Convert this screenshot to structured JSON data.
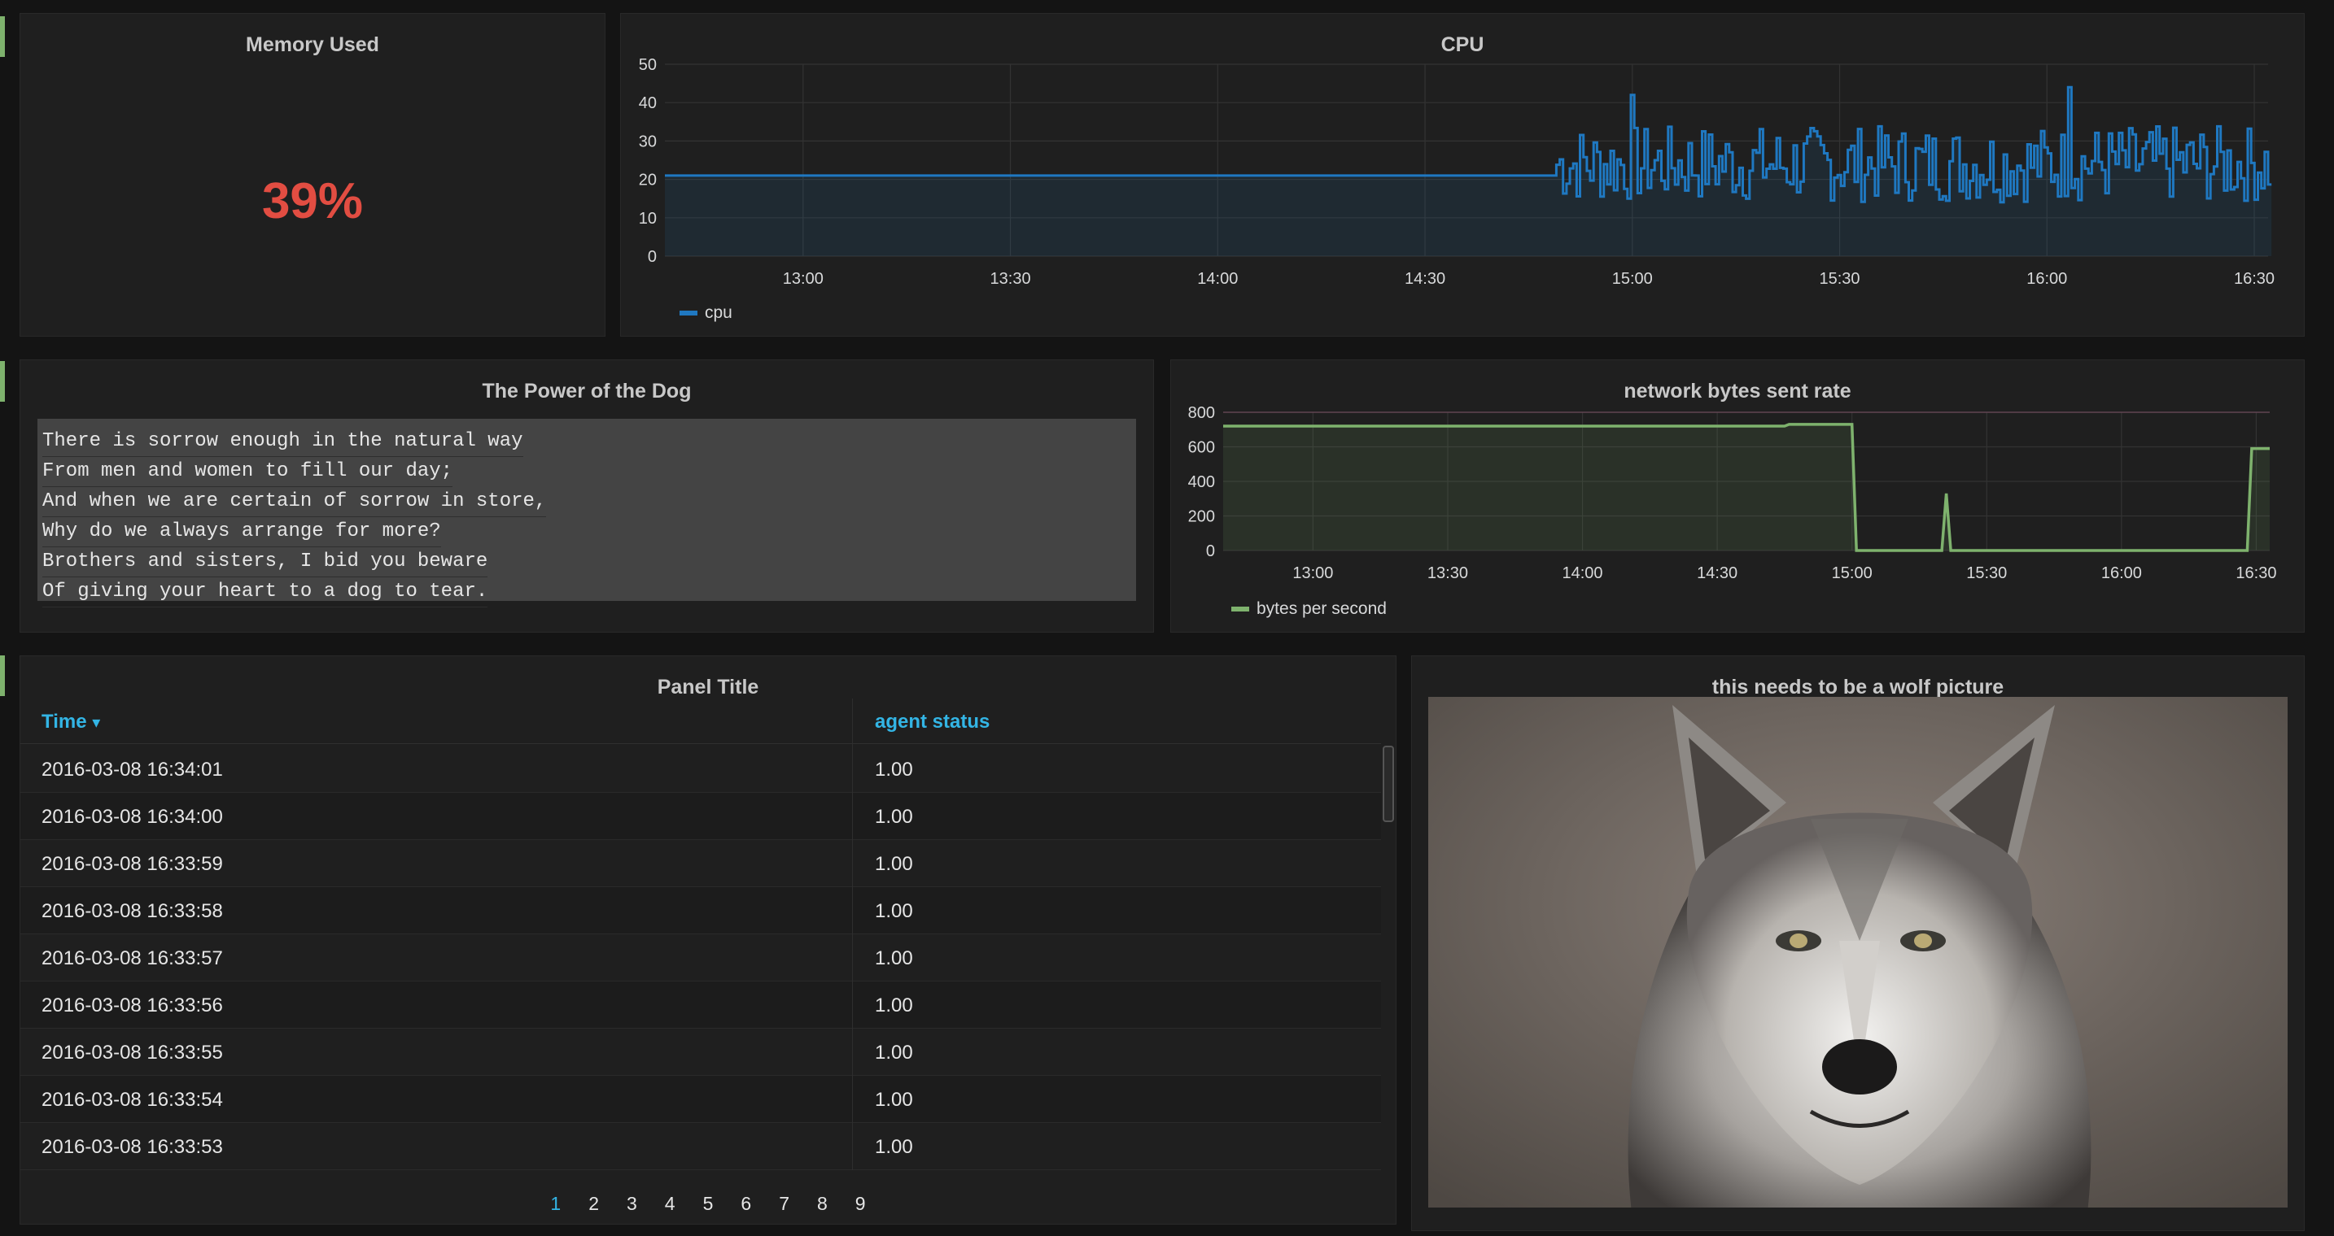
{
  "colors": {
    "background": "#141414",
    "panel": "#1f1f1f",
    "accent_blue": "#33b5e5",
    "cpu_series": "#1f78c1",
    "net_series": "#7eb26d",
    "memory_value": "#e24d42",
    "row_marker": "#7eb26d"
  },
  "memory_panel": {
    "title": "Memory Used",
    "value": "39%"
  },
  "cpu_panel": {
    "title": "CPU",
    "legend": "cpu",
    "y_ticks": [
      "0",
      "10",
      "20",
      "30",
      "40",
      "50"
    ],
    "x_ticks": [
      "13:00",
      "13:30",
      "14:00",
      "14:30",
      "15:00",
      "15:30",
      "16:00",
      "16:30"
    ]
  },
  "poem_panel": {
    "title": "The Power of the Dog",
    "lines": [
      "There is sorrow enough in the natural way",
      "From men and women to fill our day;",
      "And when we are certain of sorrow in store,",
      "Why do we always arrange for more?",
      "Brothers and sisters, I bid you beware",
      "Of giving your heart to a dog to tear."
    ]
  },
  "network_panel": {
    "title": "network bytes sent rate",
    "legend": "bytes per second",
    "y_ticks": [
      "0",
      "200",
      "400",
      "600",
      "800"
    ],
    "x_ticks": [
      "13:00",
      "13:30",
      "14:00",
      "14:30",
      "15:00",
      "15:30",
      "16:00",
      "16:30"
    ]
  },
  "table_panel": {
    "title": "Panel Title",
    "columns": [
      "Time",
      "agent status"
    ],
    "sort_indicator": "▾",
    "rows": [
      [
        "2016-03-08 16:34:01",
        "1.00"
      ],
      [
        "2016-03-08 16:34:00",
        "1.00"
      ],
      [
        "2016-03-08 16:33:59",
        "1.00"
      ],
      [
        "2016-03-08 16:33:58",
        "1.00"
      ],
      [
        "2016-03-08 16:33:57",
        "1.00"
      ],
      [
        "2016-03-08 16:33:56",
        "1.00"
      ],
      [
        "2016-03-08 16:33:55",
        "1.00"
      ],
      [
        "2016-03-08 16:33:54",
        "1.00"
      ],
      [
        "2016-03-08 16:33:53",
        "1.00"
      ]
    ],
    "pages": [
      "1",
      "2",
      "3",
      "4",
      "5",
      "6",
      "7",
      "8",
      "9"
    ],
    "active_page": "1"
  },
  "image_panel": {
    "title": "this needs to be a wolf picture"
  },
  "chart_data": [
    {
      "type": "line",
      "title": "CPU",
      "series": [
        {
          "name": "cpu",
          "segments": [
            {
              "x_range": [
                "12:40",
                "14:49"
              ],
              "y": 21
            },
            {
              "x_range": [
                "14:49",
                "16:32"
              ],
              "y_between": [
                10,
                44
              ],
              "pattern": "noisy",
              "peaks": [
                42,
                44
              ]
            }
          ]
        }
      ],
      "ylim": [
        0,
        50
      ],
      "grid": true,
      "legend_position": "bottom-left"
    },
    {
      "type": "line",
      "title": "network bytes sent rate",
      "series": [
        {
          "name": "bytes per second",
          "x": [
            "12:40",
            "14:45",
            "14:46",
            "15:00",
            "15:01",
            "15:20",
            "15:21",
            "15:22",
            "16:28",
            "16:29",
            "16:33"
          ],
          "y": [
            720,
            720,
            730,
            730,
            0,
            0,
            330,
            0,
            0,
            590,
            590
          ]
        }
      ],
      "ylim": [
        0,
        800
      ],
      "grid": true,
      "legend_position": "bottom-left"
    }
  ]
}
